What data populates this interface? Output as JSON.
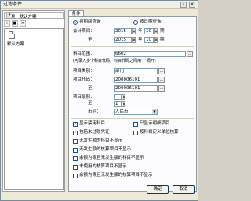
{
  "window": {
    "title": "过滤条件",
    "help": "?",
    "close": "×"
  },
  "left": {
    "scheme_label": "方案：默认方案",
    "toolbar": [
      {
        "icon": "new-icon"
      },
      {
        "icon": "save-icon"
      },
      {
        "icon": "delete-icon"
      }
    ],
    "schemes": [
      {
        "label": "默认方案"
      }
    ]
  },
  "tabs": [
    {
      "label": "条件"
    }
  ],
  "conditions": {
    "mode": {
      "options": [
        "按期间查询",
        "按日期查询"
      ],
      "selected": 0
    },
    "start_period": {
      "label": "会计期间：",
      "year": "2015",
      "year_unit": "年",
      "period": "10",
      "period_unit": "期"
    },
    "end_period": {
      "label": "至：",
      "year": "2015",
      "year_unit": "年",
      "period": "10",
      "period_unit": "期"
    },
    "account_code": {
      "label": "科目范围：",
      "value": "6602"
    },
    "account_hint": "(可录入多个科目代码，科目代码之间用“,”隔开)",
    "project_category": {
      "label": "项目类别：",
      "value": "部门"
    },
    "project_code": {
      "label": "项目代码：",
      "value": "200006101"
    },
    "project_code_to": {
      "label": "至：",
      "value": "200006101"
    },
    "project_level": {
      "label": "项目级别：",
      "value": "1",
      "to": "至"
    },
    "currency": {
      "label": "币别：",
      "value": "人民币"
    },
    "options": [
      {
        "label": "显示禁用科目",
        "checked": true
      },
      {
        "label": "只显示明细项目",
        "checked": false
      },
      {
        "label": "包括未过账凭证",
        "checked": true
      },
      {
        "label": "按科目定义单位核算",
        "checked": false
      },
      {
        "label": "无发生额的科目不显示",
        "checked": false
      },
      {
        "label": "无发生额的核算项目不显示",
        "checked": false
      },
      {
        "label": "余额为零且无发生额的科目不显示",
        "checked": false
      },
      {
        "label": "未使用的核算项目不显示",
        "checked": false
      },
      {
        "label": "余额为零且无发生额的核算项目不显示",
        "checked": false
      }
    ]
  },
  "buttons": {
    "ok": "确定",
    "cancel": "取消"
  }
}
